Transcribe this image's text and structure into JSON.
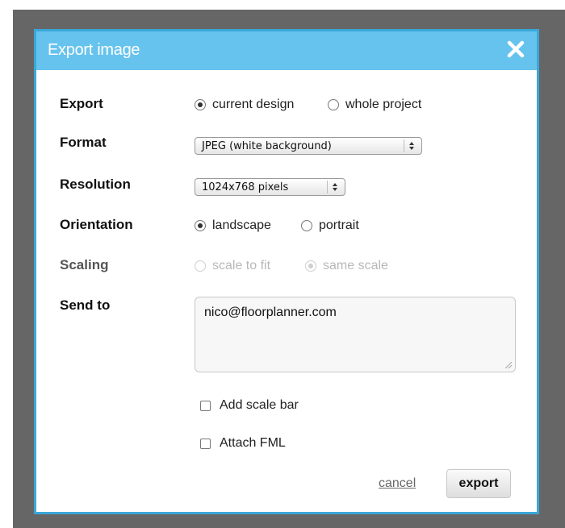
{
  "dialog": {
    "title": "Export image",
    "close_icon": "close-icon"
  },
  "fields": {
    "export": {
      "label": "Export",
      "options": [
        {
          "label": "current design",
          "checked": true
        },
        {
          "label": "whole project",
          "checked": false
        }
      ]
    },
    "format": {
      "label": "Format",
      "selected": "JPEG (white background)"
    },
    "resolution": {
      "label": "Resolution",
      "selected": "1024x768 pixels"
    },
    "orientation": {
      "label": "Orientation",
      "options": [
        {
          "label": "landscape",
          "checked": true
        },
        {
          "label": "portrait",
          "checked": false
        }
      ]
    },
    "scaling": {
      "label": "Scaling",
      "disabled": true,
      "options": [
        {
          "label": "scale to fit",
          "checked": false
        },
        {
          "label": "same scale",
          "checked": true
        }
      ]
    },
    "send_to": {
      "label": "Send to",
      "value": "nico@floorplanner.com"
    }
  },
  "checkboxes": [
    {
      "label": "Add scale bar",
      "checked": false
    },
    {
      "label": "Attach FML",
      "checked": false
    }
  ],
  "actions": {
    "cancel": "cancel",
    "export": "export"
  },
  "colors": {
    "title_bar": "#66c3ee",
    "dialog_border": "#3aa7d9",
    "backdrop": "#666666"
  }
}
